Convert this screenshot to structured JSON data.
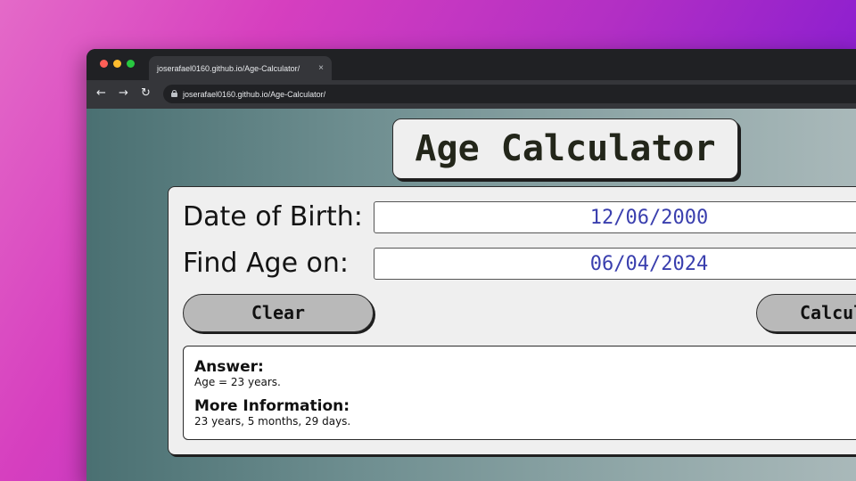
{
  "browser": {
    "tab_title": "joserafael0160.github.io/Age-Calculator/",
    "tab_close": "×",
    "url": "joserafael0160.github.io/Age-Calculator/",
    "back": "←",
    "forward": "→",
    "reload": "↻"
  },
  "app": {
    "title": "Age Calculator",
    "dob_label": "Date of Birth:",
    "dob_value": "12/06/2000",
    "find_label": "Find Age on:",
    "find_value": "06/04/2024",
    "clear_label": "Clear",
    "calculate_label": "Calculate"
  },
  "result": {
    "answer_heading": "Answer:",
    "answer_text": "Age = 23 years.",
    "more_heading": "More Information:",
    "more_text": "23 years, 5 months, 29 days."
  }
}
